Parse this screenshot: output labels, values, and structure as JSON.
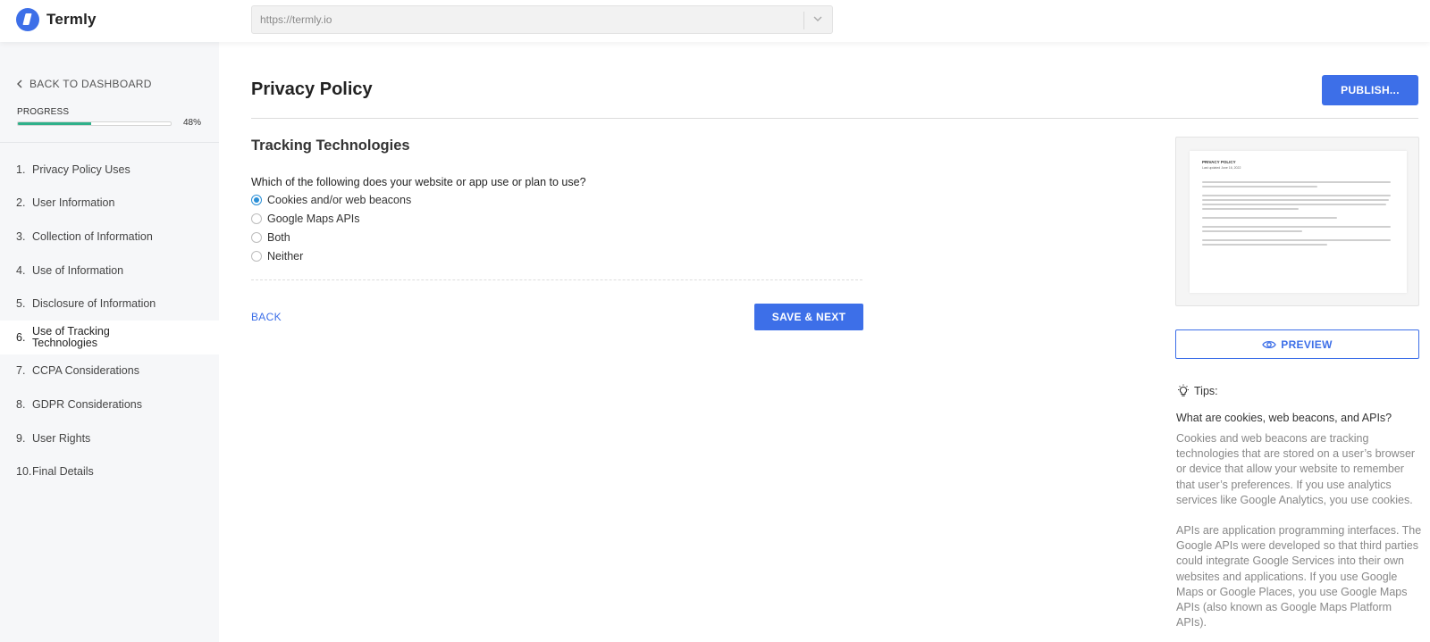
{
  "brand": {
    "name": "Termly"
  },
  "url_select": {
    "value": "https://termly.io"
  },
  "sidebar": {
    "back_label": "BACK TO DASHBOARD",
    "progress_label": "PROGRESS",
    "progress_percent": 48,
    "progress_text": "48%",
    "steps": [
      {
        "num": "1.",
        "label": "Privacy Policy Uses"
      },
      {
        "num": "2.",
        "label": "User Information"
      },
      {
        "num": "3.",
        "label": "Collection of Information"
      },
      {
        "num": "4.",
        "label": "Use of Information"
      },
      {
        "num": "5.",
        "label": "Disclosure of Information"
      },
      {
        "num": "6.",
        "label": "Use of Tracking Technologies"
      },
      {
        "num": "7.",
        "label": "CCPA Considerations"
      },
      {
        "num": "8.",
        "label": "GDPR Considerations"
      },
      {
        "num": "9.",
        "label": "User Rights"
      },
      {
        "num": "10.",
        "label": "Final Details"
      }
    ],
    "active_step": 6
  },
  "main": {
    "title": "Privacy Policy",
    "publish_label": "PUBLISH...",
    "section_title": "Tracking Technologies",
    "question": "Which of the following does your website or app use or plan to use?",
    "options": [
      {
        "label": "Cookies and/or web beacons",
        "checked": true
      },
      {
        "label": "Google Maps APIs",
        "checked": false
      },
      {
        "label": "Both",
        "checked": false
      },
      {
        "label": "Neither",
        "checked": false
      }
    ],
    "back_label": "BACK",
    "save_label": "SAVE & NEXT"
  },
  "right_panel": {
    "doc_preview": {
      "title": "PRIVACY POLICY",
      "date": "Last updated June 16, 2022"
    },
    "preview_label": "PREVIEW",
    "tips_label": "Tips:",
    "tips_question": "What are cookies, web beacons, and APIs?",
    "tips_p1": "Cookies and web beacons are tracking technologies that are stored on a user’s browser or device that allow your website to remember that user’s preferences. If you use analytics services like Google Analytics, you use cookies.",
    "tips_p2": "APIs are application programming interfaces. The Google APIs were developed so that third parties could integrate Google Services into their own websites and applications. If you use Google Maps or Google Places, you use Google Maps APIs (also known as Google Maps Platform APIs)."
  },
  "colors": {
    "accent": "#3d6fe8",
    "progress": "#2fb08a",
    "radio_checked": "#2a8fd6",
    "sidebar_bg": "#f6f7f9"
  },
  "icons": {
    "logo": "termly-logo-icon",
    "back": "chevron-left-icon",
    "url_dropdown": "chevron-down-icon",
    "preview": "eye-icon",
    "tips": "lightbulb-icon"
  }
}
